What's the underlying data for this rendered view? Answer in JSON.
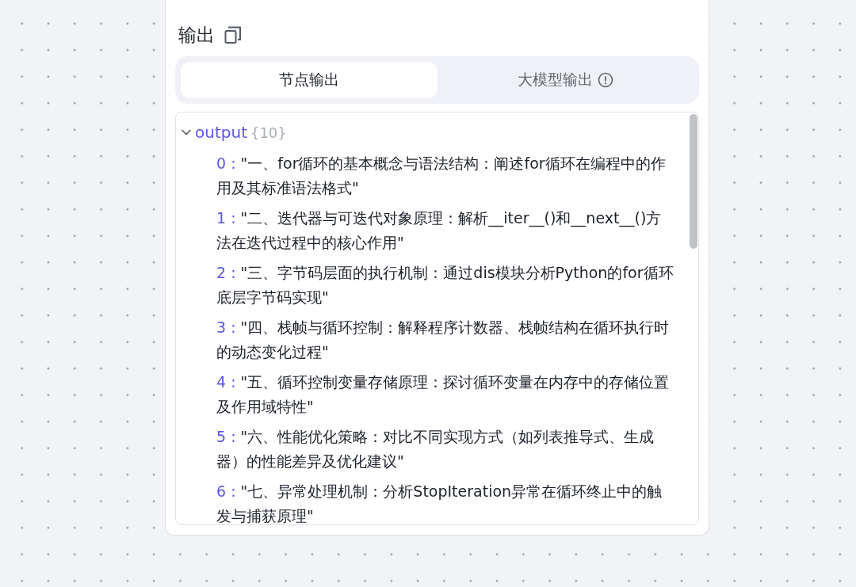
{
  "panel": {
    "title": "输出",
    "tabs": [
      {
        "label": "节点输出",
        "selected": true,
        "info": false
      },
      {
        "label": "大模型输出",
        "selected": false,
        "info": true
      }
    ],
    "tree": {
      "name": "output",
      "count": "{10}",
      "expanded": true,
      "items": [
        {
          "key": "0 :",
          "value": "\"一、for循环的基本概念与语法结构：阐述for循环在编程中的作用及其标准语法格式\""
        },
        {
          "key": "1 :",
          "value": "\"二、迭代器与可迭代对象原理：解析__iter__()和__next__()方法在迭代过程中的核心作用\""
        },
        {
          "key": "2 :",
          "value": "\"三、字节码层面的执行机制：通过dis模块分析Python的for循环底层字节码实现\""
        },
        {
          "key": "3 :",
          "value": "\"四、栈帧与循环控制：解释程序计数器、栈帧结构在循环执行时的动态变化过程\""
        },
        {
          "key": "4 :",
          "value": "\"五、循环控制变量存储原理：探讨循环变量在内存中的存储位置及作用域特性\""
        },
        {
          "key": "5 :",
          "value": "\"六、性能优化策略：对比不同实现方式（如列表推导式、生成器）的性能差异及优化建议\""
        },
        {
          "key": "6 :",
          "value": "\"七、异常处理机制：分析StopIteration异常在循环终止中的触发与捕获原理\""
        }
      ]
    }
  }
}
